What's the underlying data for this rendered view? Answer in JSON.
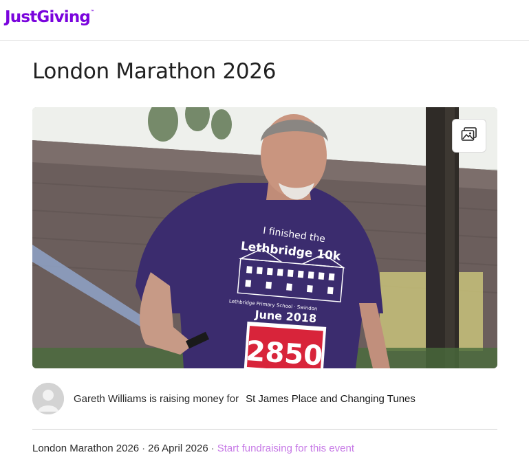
{
  "header": {
    "logo_text": "JustGiving",
    "logo_tm": "™",
    "brand_color": "#7a04dd"
  },
  "page": {
    "title": "London Marathon 2026"
  },
  "hero": {
    "shirt_line1": "I finished the",
    "shirt_line2": "Lethbridge 10k",
    "shirt_line3": "Lethbridge Primary School · Swindon",
    "shirt_line4": "June 2018",
    "bib_number": "2850",
    "gallery_icon": "image-gallery-icon"
  },
  "owner": {
    "avatar_icon": "user-avatar-icon",
    "text": "Gareth Williams is raising money for",
    "charity": "St James Place and Changing Tunes"
  },
  "event": {
    "name": "London Marathon 2026",
    "date": "26 April 2026",
    "separator": "·",
    "start_link": "Start fundraising for this event",
    "link_color": "#c678e6"
  }
}
